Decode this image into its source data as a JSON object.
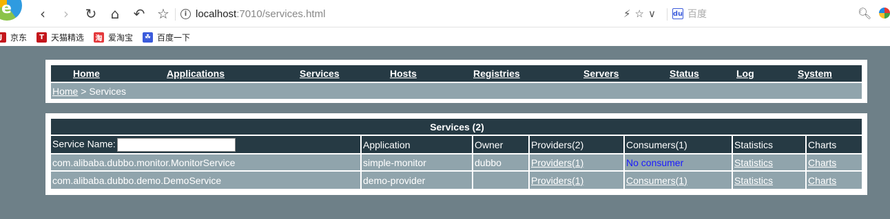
{
  "browser": {
    "url_host": "localhost",
    "url_path": ":7010/services.html",
    "search_placeholder": "百度",
    "bookmarks": [
      {
        "label": "京东",
        "icon": "jd-icon",
        "color": "#c4161c"
      },
      {
        "label": "天猫精选",
        "icon": "tmall-icon",
        "color": "#c4161c"
      },
      {
        "label": "爱淘宝",
        "icon": "aitaobao-icon",
        "color": "#e4393c"
      },
      {
        "label": "百度一下",
        "icon": "baidu-paw-icon",
        "color": "#3b5bdb"
      }
    ]
  },
  "menu": {
    "items": [
      "Home",
      "Applications",
      "Services",
      "Hosts",
      "Registries",
      "Servers",
      "Status",
      "Log",
      "System"
    ]
  },
  "breadcrumb": {
    "home": "Home",
    "separator": " > ",
    "current": "Services"
  },
  "services_table": {
    "caption": "Services (2)",
    "search_label": "Service Name:",
    "search_value": "",
    "headers": [
      "Application",
      "Owner",
      "Providers(2)",
      "Consumers(1)",
      "Statistics",
      "Charts"
    ],
    "rows": [
      {
        "service": "com.alibaba.dubbo.monitor.MonitorService",
        "application": "simple-monitor",
        "owner": "dubbo",
        "providers": "Providers(1)",
        "consumers": "No consumer",
        "statistics": "Statistics",
        "charts": "Charts"
      },
      {
        "service": "com.alibaba.dubbo.demo.DemoService",
        "application": "demo-provider",
        "owner": "",
        "providers": "Providers(1)",
        "consumers": "Consumers(1)",
        "statistics": "Statistics",
        "charts": "Charts"
      }
    ]
  },
  "colors": {
    "page_bg": "#6e8088",
    "header_bg": "#263a44",
    "row_bg": "#90a4ac",
    "no_consumer": "#1a1aff"
  }
}
